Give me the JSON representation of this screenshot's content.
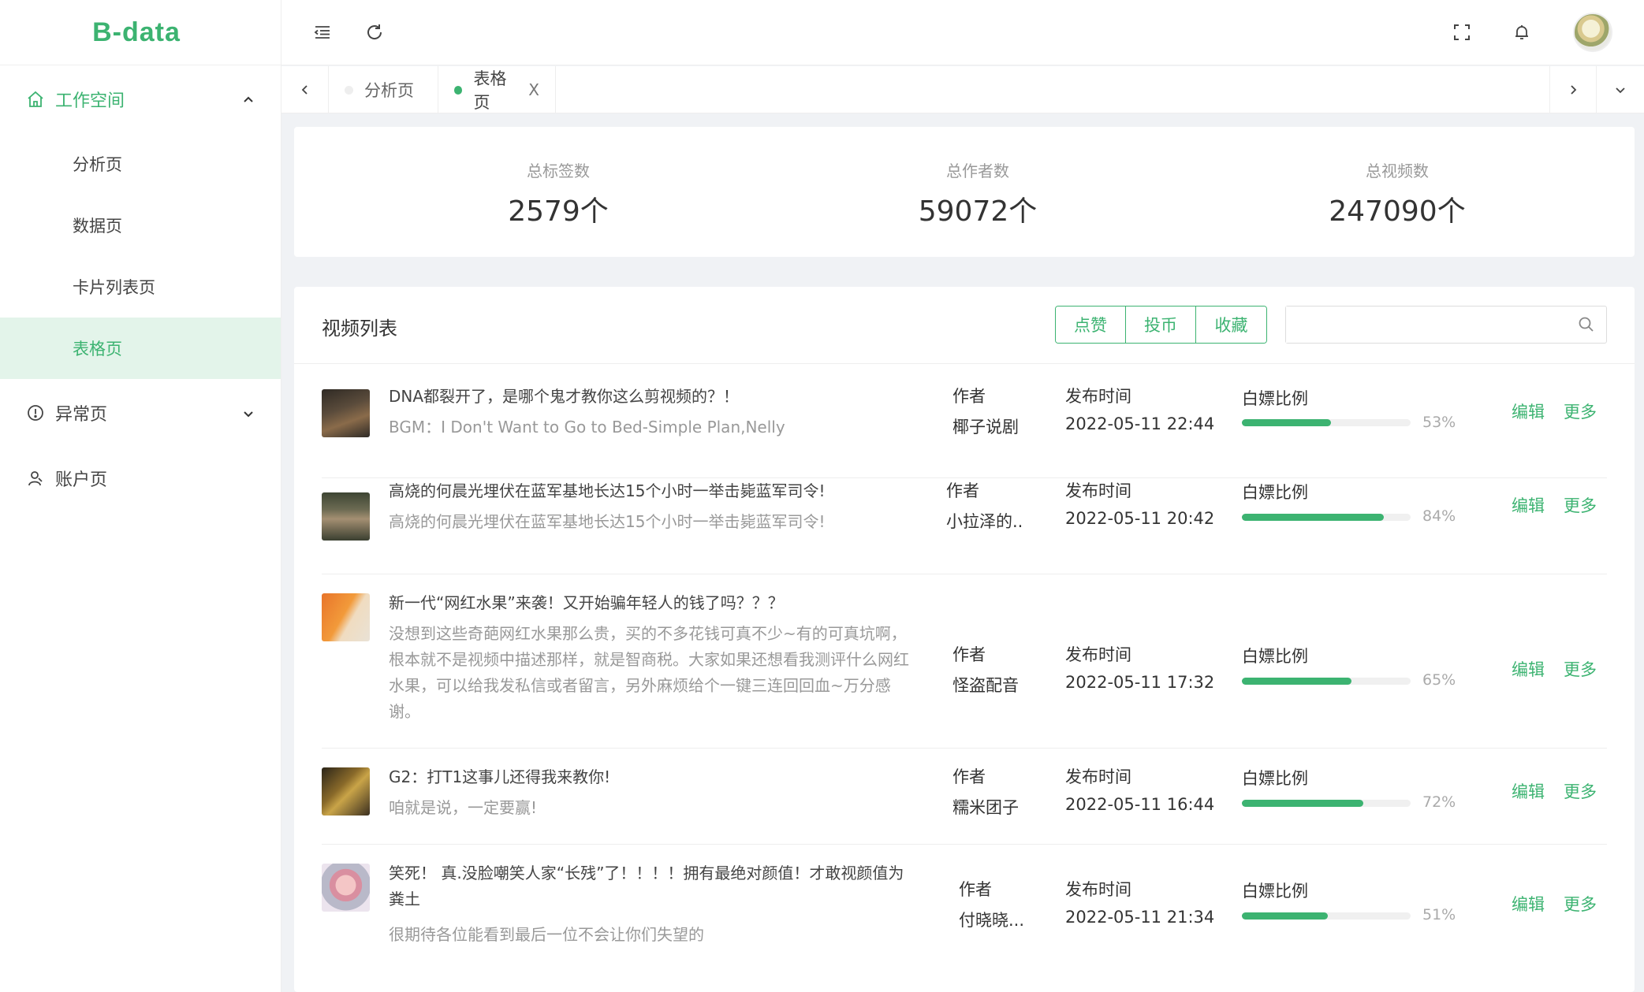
{
  "app": {
    "logo": "B-data"
  },
  "sidebar": {
    "workspace": {
      "label": "工作空间",
      "icon": "home-icon"
    },
    "workspace_items": [
      {
        "label": "分析页"
      },
      {
        "label": "数据页"
      },
      {
        "label": "卡片列表页"
      },
      {
        "label": "表格页",
        "selected": true
      }
    ],
    "exception": {
      "label": "异常页",
      "icon": "info-circle-icon"
    },
    "account": {
      "label": "账户页",
      "icon": "user-icon"
    }
  },
  "header": {
    "icons": [
      "menu-fold-icon",
      "refresh-icon",
      "fullscreen-icon",
      "bell-icon",
      "user-avatar"
    ]
  },
  "tabs": [
    {
      "label": "分析页",
      "active": false
    },
    {
      "label": "表格页",
      "active": true,
      "close": "X"
    }
  ],
  "stats": [
    {
      "label": "总标签数",
      "value": "2579个"
    },
    {
      "label": "总作者数",
      "value": "59072个"
    },
    {
      "label": "总视频数",
      "value": "247090个"
    }
  ],
  "video_list": {
    "title": "视频列表",
    "filters": [
      "点赞",
      "投币",
      "收藏"
    ],
    "search": {
      "placeholder": "",
      "value": ""
    },
    "labels": {
      "author": "作者",
      "time": "发布时间",
      "ratio": "白嫖比例",
      "edit": "编辑",
      "more": "更多"
    },
    "rows": [
      {
        "title": "DNA都裂开了，是哪个鬼才教你这么剪视频的？！",
        "desc": "BGM：I Don't Want to Go to Bed-Simple Plan,Nelly",
        "author": "椰子说剧",
        "time": "2022-05-11 22:44",
        "ratio": 53,
        "ratio_text": "53%"
      },
      {
        "title": "高烧的何晨光埋伏在蓝军基地长达15个小时一举击毙蓝军司令!",
        "desc": "高烧的何晨光埋伏在蓝军基地长达15个小时一举击毙蓝军司令!",
        "author": "小拉泽的..",
        "time": "2022-05-11 20:42",
        "ratio": 84,
        "ratio_text": "84%"
      },
      {
        "title": "新一代“网红水果”来袭！又开始骗年轻人的钱了吗？？？",
        "desc": "没想到这些奇葩网红水果那么贵，买的不多花钱可真不少~有的可真坑啊，根本就不是视频中描述那样，就是智商税。大家如果还想看我测评什么网红水果，可以给我发私信或者留言，另外麻烦给个一键三连回回血~万分感谢。",
        "author": "怪盗配音",
        "time": "2022-05-11 17:32",
        "ratio": 65,
        "ratio_text": "65%"
      },
      {
        "title": "G2：打T1这事儿还得我来教你!",
        "desc": "咱就是说，一定要赢!",
        "author": "糯米团子",
        "time": "2022-05-11 16:44",
        "ratio": 72,
        "ratio_text": "72%"
      },
      {
        "title": "笑死！ 真.没脸嘲笑人家“长残”了！！！！拥有最绝对颜值！才敢视颜值为粪土",
        "desc": "很期待各位能看到最后一位不会让你们失望的",
        "author": "付晓晓...",
        "time": "2022-05-11 21:34",
        "ratio": 51,
        "ratio_text": "51%"
      }
    ]
  }
}
